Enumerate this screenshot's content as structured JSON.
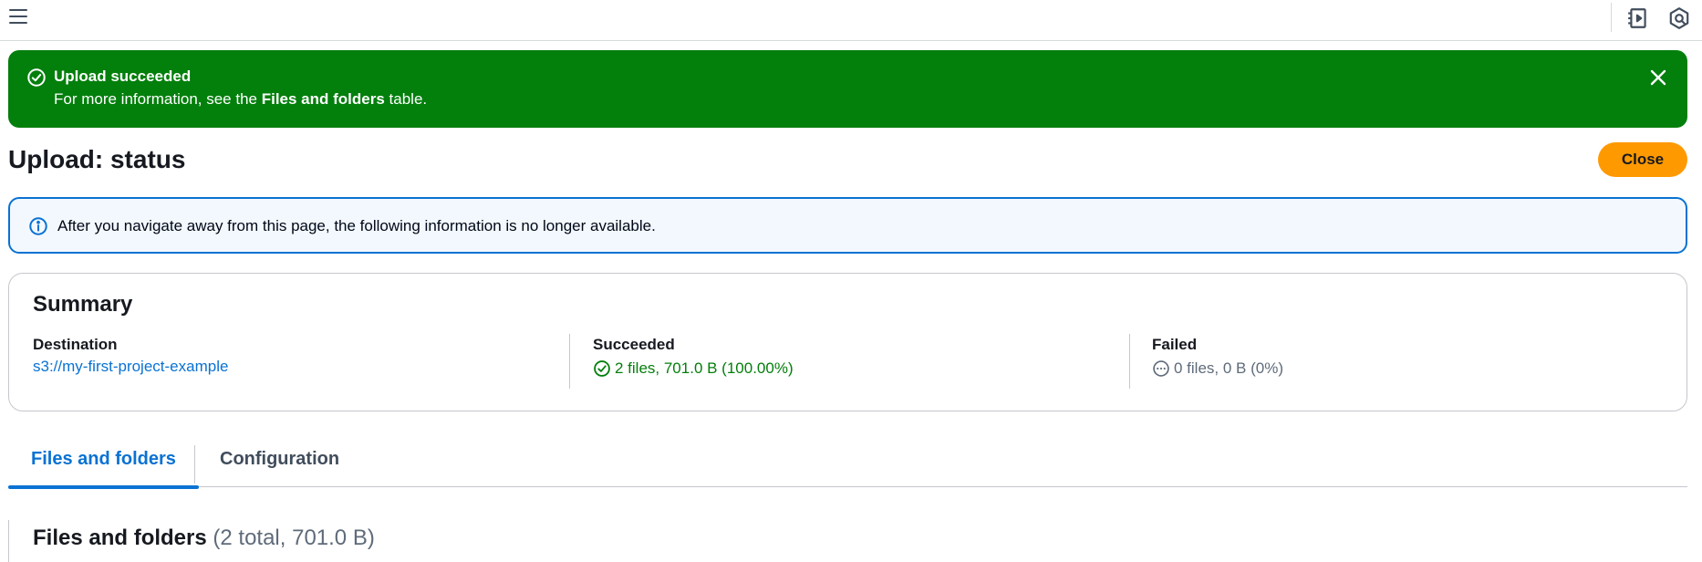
{
  "topbar": {
    "menu_icon": "hamburger-icon",
    "right_icons": [
      "side-panel-icon",
      "notifications-icon"
    ]
  },
  "flash": {
    "title": "Upload succeeded",
    "body_prefix": "For more information, see the ",
    "body_bold": "Files and folders",
    "body_suffix": " table.",
    "color": "#037f0c"
  },
  "page": {
    "title": "Upload: status",
    "close_label": "Close"
  },
  "info": {
    "text": "After you navigate away from this page, the following information is no longer available."
  },
  "summary": {
    "title": "Summary",
    "destination_label": "Destination",
    "destination_value": "s3://my-first-project-example",
    "succeeded_label": "Succeeded",
    "succeeded_value": "2 files, 701.0 B (100.00%)",
    "failed_label": "Failed",
    "failed_value": "0 files, 0 B (0%)"
  },
  "tabs": [
    {
      "label": "Files and folders",
      "active": true
    },
    {
      "label": "Configuration",
      "active": false
    }
  ],
  "files_section": {
    "heading": "Files and folders",
    "count": "(2 total, 701.0 B)"
  },
  "colors": {
    "success": "#037f0c",
    "accent": "#0972d3",
    "primary_button": "#ff9900"
  }
}
